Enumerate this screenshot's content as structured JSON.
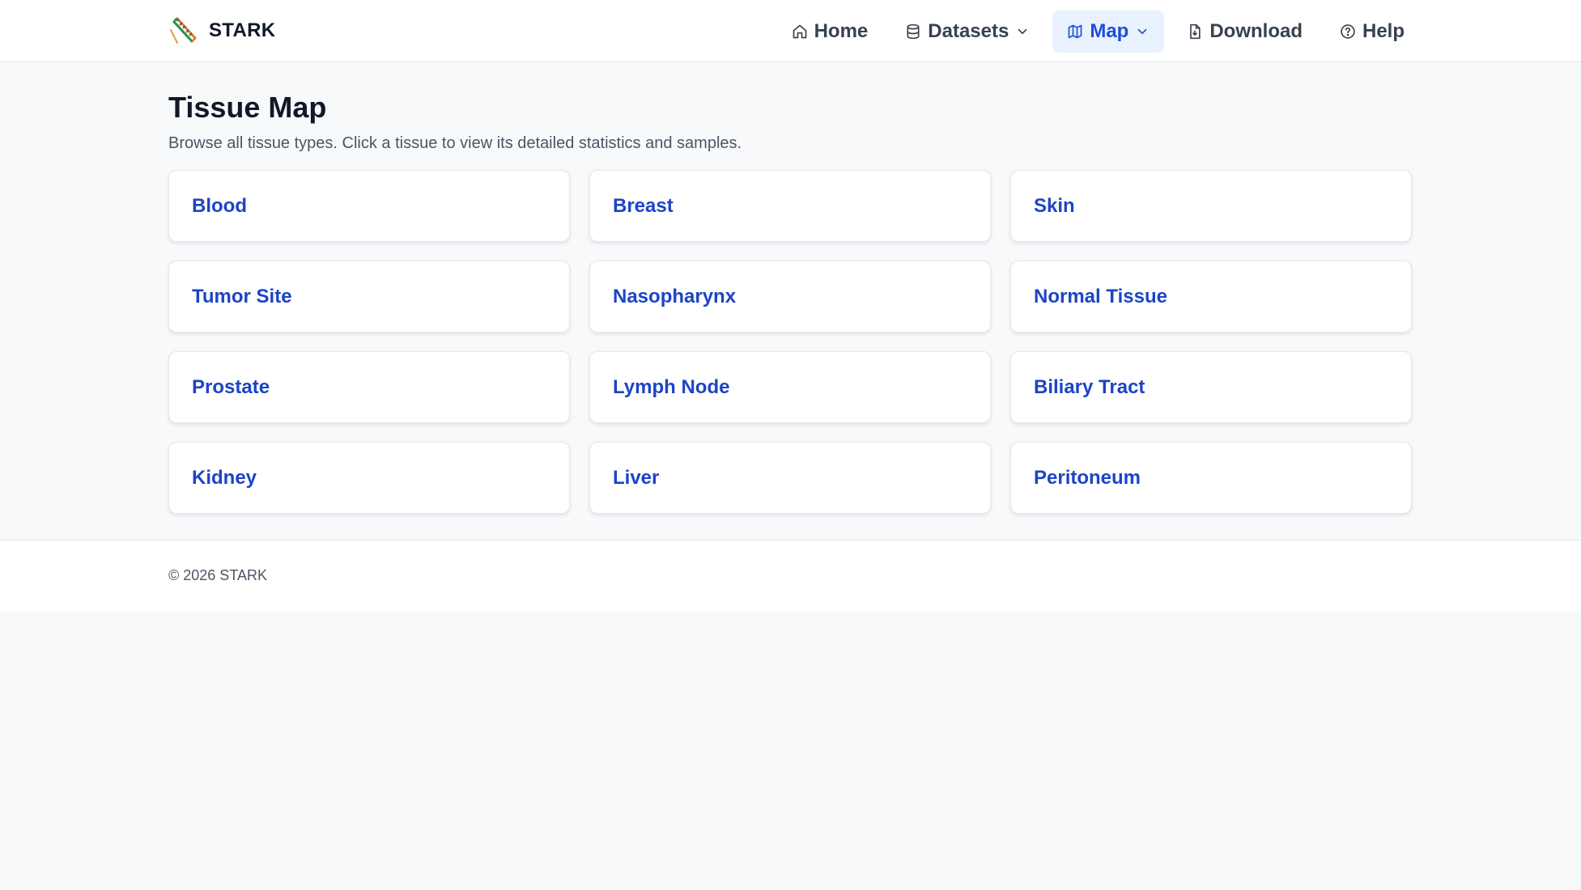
{
  "brand": {
    "name": "STARK",
    "logo_icon": "helix-logo-icon"
  },
  "nav": {
    "items": [
      {
        "label": "Home",
        "icon": "home-icon",
        "active": false
      },
      {
        "label": "Datasets",
        "icon": "database-icon",
        "dropdown": true,
        "active": false
      },
      {
        "label": "Map",
        "icon": "map-icon",
        "dropdown": true,
        "active": true
      },
      {
        "label": "Download",
        "icon": "download-file-icon",
        "active": false
      },
      {
        "label": "Help",
        "icon": "help-circle-icon",
        "active": false
      }
    ]
  },
  "page": {
    "title": "Tissue Map",
    "subtitle": "Browse all tissue types. Click a tissue to view its detailed statistics and samples."
  },
  "tissues": [
    "Blood",
    "Breast",
    "Skin",
    "Tumor Site",
    "Nasopharynx",
    "Normal Tissue",
    "Prostate",
    "Lymph Node",
    "Biliary Tract",
    "Kidney",
    "Liver",
    "Peritoneum"
  ],
  "footer": {
    "copyright": "© 2026 STARK"
  },
  "colors": {
    "accent": "#1d4ed8",
    "card_text": "#1d44c5",
    "active_nav_bg": "#eaf1ff",
    "page_bg": "#f8f9fb"
  }
}
